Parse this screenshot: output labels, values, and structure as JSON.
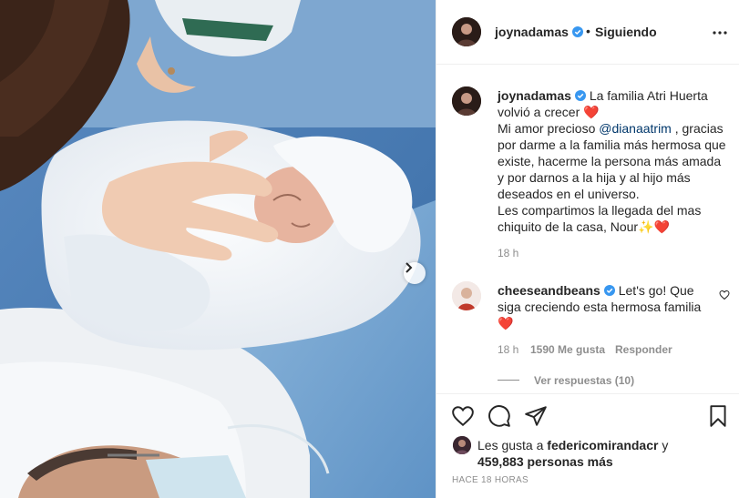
{
  "post": {
    "author": "joynadamas",
    "follow_separator": "•",
    "follow_status": "Siguiendo",
    "caption": {
      "author": "joynadamas",
      "line_1": "La familia Atri Huerta volvió a crecer",
      "emoji_1": "❤️",
      "line_2_pre": "Mi amor precioso ",
      "mention": "@dianaatrim",
      "line_2_post": " , gracias por darme a la familia más hermosa que existe, hacerme la persona más amada y por darnos a la hija y al hijo más deseados en el universo.",
      "line_3": "Les compartimos la llegada del mas chiquito de la casa, Nour",
      "emoji_2": "✨❤️",
      "time": "18 h"
    },
    "comment": {
      "author": "cheeseandbeans",
      "text": "Let's go! Que siga creciendo esta hermosa familia",
      "emoji": "❤️",
      "time": "18 h",
      "likes": "1590 Me gusta",
      "reply": "Responder",
      "view_replies": "Ver respuestas (10)"
    },
    "likes": {
      "prefix": "Les gusta a ",
      "user": "federicomirandacr",
      "middle": " y",
      "count": "459,883 personas más"
    },
    "posted": "HACE 18 HORAS"
  },
  "icons": {
    "verified": "verified-badge-icon",
    "more": "more-options-icon",
    "next": "chevron-right-icon",
    "like": "heart-icon",
    "comment": "comment-icon",
    "share": "send-icon",
    "save": "bookmark-icon"
  },
  "colors": {
    "verified": "#3897f0",
    "link": "#00376b",
    "muted": "#8e8e8e",
    "text": "#262626"
  }
}
